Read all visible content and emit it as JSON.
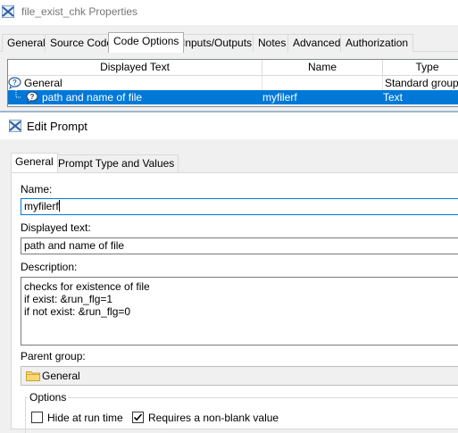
{
  "properties_window": {
    "title": "file_exist_chk Properties",
    "tabs": [
      {
        "label": "General",
        "active": false
      },
      {
        "label": "Source Code",
        "active": false
      },
      {
        "label": "Code Options",
        "active": true
      },
      {
        "label": "Inputs/Outputs",
        "active": false
      },
      {
        "label": "Notes",
        "active": false
      },
      {
        "label": "Advanced",
        "active": false
      },
      {
        "label": "Authorization",
        "active": false
      }
    ],
    "grid": {
      "columns": [
        "Displayed Text",
        "Name",
        "Type"
      ],
      "rows": [
        {
          "displayed_text": "General",
          "name": "",
          "type": "Standard group",
          "selected": false
        },
        {
          "displayed_text": "path and name of file",
          "name": "myfilerf",
          "type": "Text",
          "selected": true
        }
      ]
    }
  },
  "edit_prompt": {
    "title": "Edit Prompt",
    "tabs": [
      {
        "label": "General",
        "active": true
      },
      {
        "label": "Prompt Type and Values",
        "active": false
      }
    ],
    "name_label": "Name:",
    "name_value": "myfilerf",
    "displayed_text_label": "Displayed text:",
    "displayed_text_value": "path and name of file",
    "description_label": "Description:",
    "description_lines": [
      "checks for existence of file",
      "if exist: &run_flg=1",
      "if not exist: &run_flg=0"
    ],
    "parent_group_label": "Parent group:",
    "parent_group_value": "General",
    "options_label": "Options",
    "options": [
      {
        "label": "Hide at run time",
        "checked": false
      },
      {
        "label": "Requires a non-blank value",
        "checked": true
      }
    ]
  },
  "colors": {
    "selection": "#0078d7",
    "window_bg": "#f0f0f0",
    "title_text": "#777777"
  },
  "icons": [
    "app-icon",
    "prompt-group-icon",
    "prompt-item-icon",
    "folder-icon",
    "checkmark-icon"
  ]
}
